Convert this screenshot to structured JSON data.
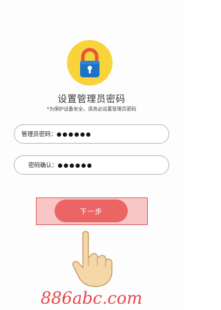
{
  "page": {
    "title": "设置管理员密码",
    "subtitle": "*为保护设备安全，请务必设置管理员密码"
  },
  "form": {
    "admin_password": {
      "label": "管理员密码：",
      "value": "●●●●●●"
    },
    "confirm_password": {
      "label": "密码确认：",
      "value": "●●●●●●"
    }
  },
  "buttons": {
    "next_label": "下一步"
  },
  "watermark": {
    "text": "886abc.com"
  },
  "icons": {
    "logo": "lock-icon",
    "pointer": "hand-pointer-icon"
  },
  "colors": {
    "logo_bg": "#f9d33a",
    "lock_body": "#1b73c9",
    "lock_shackle": "#e8533f",
    "button": "#ec6565",
    "highlight": "#f8c6c6",
    "watermark": "#e8474b"
  }
}
